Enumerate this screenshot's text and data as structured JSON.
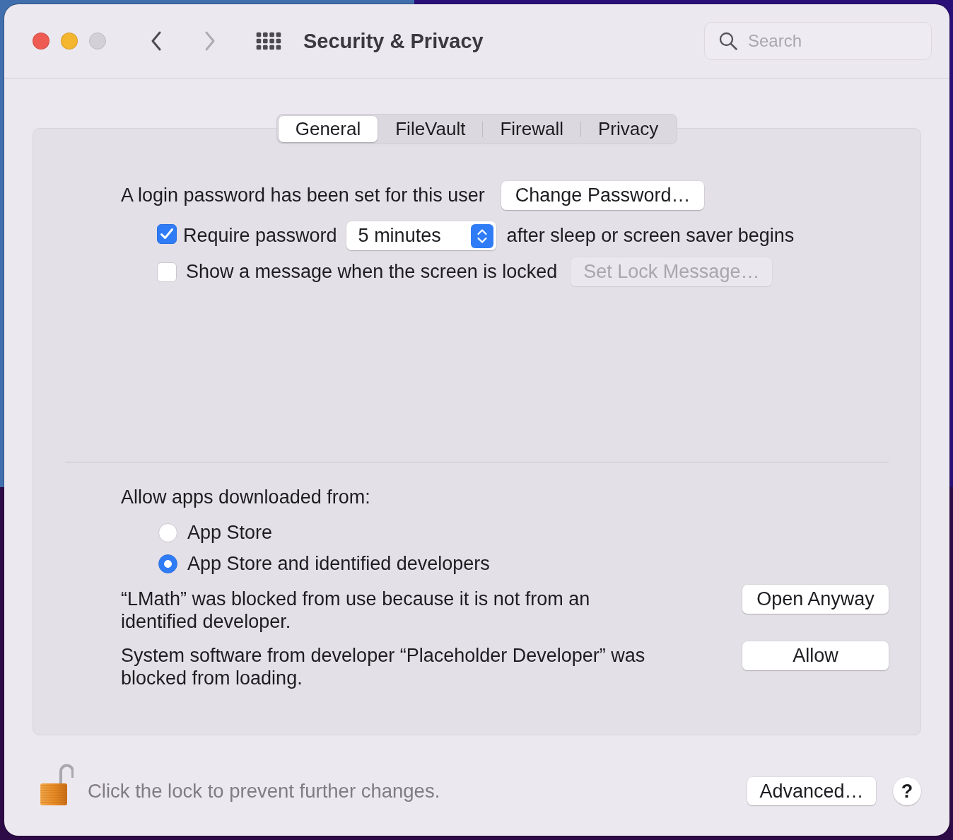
{
  "window": {
    "buttons": [
      {
        "kind": "close",
        "disabled": false
      },
      {
        "kind": "minimize",
        "disabled": false
      },
      {
        "kind": "zoom",
        "disabled": true
      }
    ],
    "nav": [
      {
        "kind": "back",
        "disabled": false
      },
      {
        "kind": "forward",
        "disabled": true
      }
    ],
    "title": "Security & Privacy",
    "search": {
      "placeholder": "Search"
    }
  },
  "tabs": [
    {
      "label": "General",
      "selected": true
    },
    {
      "label": "FileVault",
      "selected": false
    },
    {
      "label": "Firewall",
      "selected": false
    },
    {
      "label": "Privacy",
      "selected": false
    }
  ],
  "general": {
    "login_password": {
      "text": "A login password has been set for this user",
      "button": "Change Password…"
    },
    "require_password": {
      "checked": true,
      "label": "Require password",
      "delay": "5 minutes",
      "suffix": "after sleep or screen saver begins"
    },
    "lock_message": {
      "checked": false,
      "label": "Show a message when the screen is locked",
      "button": "Set Lock Message…",
      "button_disabled": true
    },
    "allow_apps": {
      "label": "Allow apps downloaded from:",
      "options": [
        {
          "label": "App Store",
          "selected": false
        },
        {
          "label": "App Store and identified developers",
          "selected": true
        }
      ]
    },
    "notices": [
      {
        "text": "“LMath” was blocked from use because it is not from an identified developer.",
        "button": "Open Anyway"
      },
      {
        "text": "System software from developer “Placeholder Developer” was blocked from loading.",
        "button": "Allow"
      }
    ]
  },
  "footer": {
    "lock": {
      "locked": false,
      "text": "Click the lock to prevent further changes."
    },
    "advanced_button": "Advanced…",
    "help_button": "?"
  }
}
